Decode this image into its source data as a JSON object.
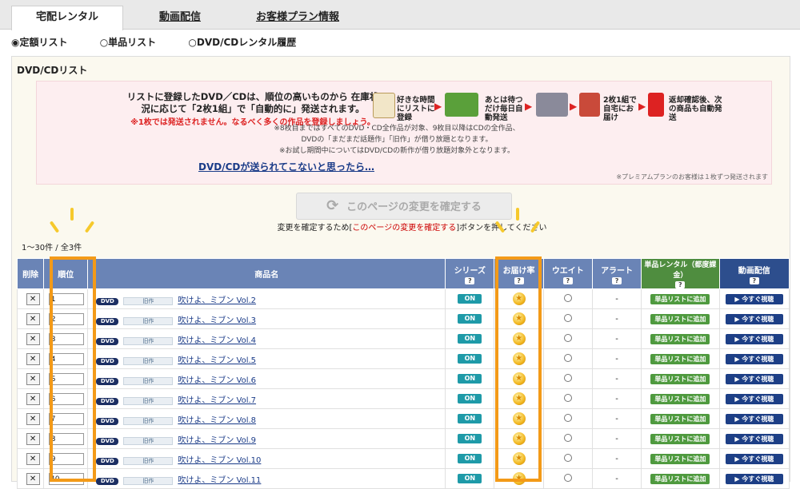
{
  "tabs": [
    {
      "label": "宅配レンタル",
      "active": true
    },
    {
      "label": "動画配信"
    },
    {
      "label": "お客様プラン情報"
    }
  ],
  "radios": [
    "定額リスト",
    "単品リスト",
    "DVD/CDレンタル履歴"
  ],
  "panel_title": "DVD/CDリスト",
  "promo": {
    "main": "リストに登録したDVD／CDは、順位の高いものから 在庫状況に応じて「2枚1組」で「自動的に」発送されます。",
    "red": "※1枚では発送されません。なるべく多くの作品を登録しましょう。",
    "steps": [
      "好きな時間にリストに登録",
      "あとは待つだけ毎日自動発送",
      "2枚1組で自宅にお届け",
      "返却確認後、次の商品も自動発送"
    ],
    "notes": [
      "※8枚目まではすべてのDVD・CD全作品が対象、9枚目以降はCDの全作品、",
      "DVDの「まだまだ話題作」「旧作」が借り放題となります。",
      "※お試し期間中についてはDVD/CDの新作が借り放題対象外となります。"
    ],
    "link": "DVD/CDが送られてこないと思ったら…",
    "premium": "※プレミアムプランのお客様は１枚ずつ発送されます"
  },
  "confirm_button": "このページの変更を確定する",
  "confirm_note_pre": "変更を確定するため[",
  "confirm_note_red": "このページの変更を確定する",
  "confirm_note_post": "]ボタンを押してください",
  "pager": "1～30件 / 全3件",
  "columns": {
    "del": "削除",
    "rank": "順位",
    "name": "商品名",
    "series": "シリーズ",
    "fav": "お届け率",
    "wait": "ウエイト",
    "alert": "アラート",
    "single": "単品レンタル（都度課金）",
    "stream": "動画配信"
  },
  "row_labels": {
    "dvd": "DVD",
    "old": "旧作",
    "on": "ON",
    "alert": "-",
    "add": "単品リストに追加",
    "play": "▶ 今すぐ視聴"
  },
  "rows": [
    {
      "rank": "1",
      "title": "吹けよ、ミブン Vol.2"
    },
    {
      "rank": "2",
      "title": "吹けよ、ミブン Vol.3"
    },
    {
      "rank": "3",
      "title": "吹けよ、ミブン Vol.4"
    },
    {
      "rank": "4",
      "title": "吹けよ、ミブン Vol.5"
    },
    {
      "rank": "5",
      "title": "吹けよ、ミブン Vol.6"
    },
    {
      "rank": "6",
      "title": "吹けよ、ミブン Vol.7"
    },
    {
      "rank": "7",
      "title": "吹けよ、ミブン Vol.8"
    },
    {
      "rank": "8",
      "title": "吹けよ、ミブン Vol.9"
    },
    {
      "rank": "9",
      "title": "吹けよ、ミブン Vol.10"
    },
    {
      "rank": "10",
      "title": "吹けよ、ミブン Vol.11"
    }
  ]
}
